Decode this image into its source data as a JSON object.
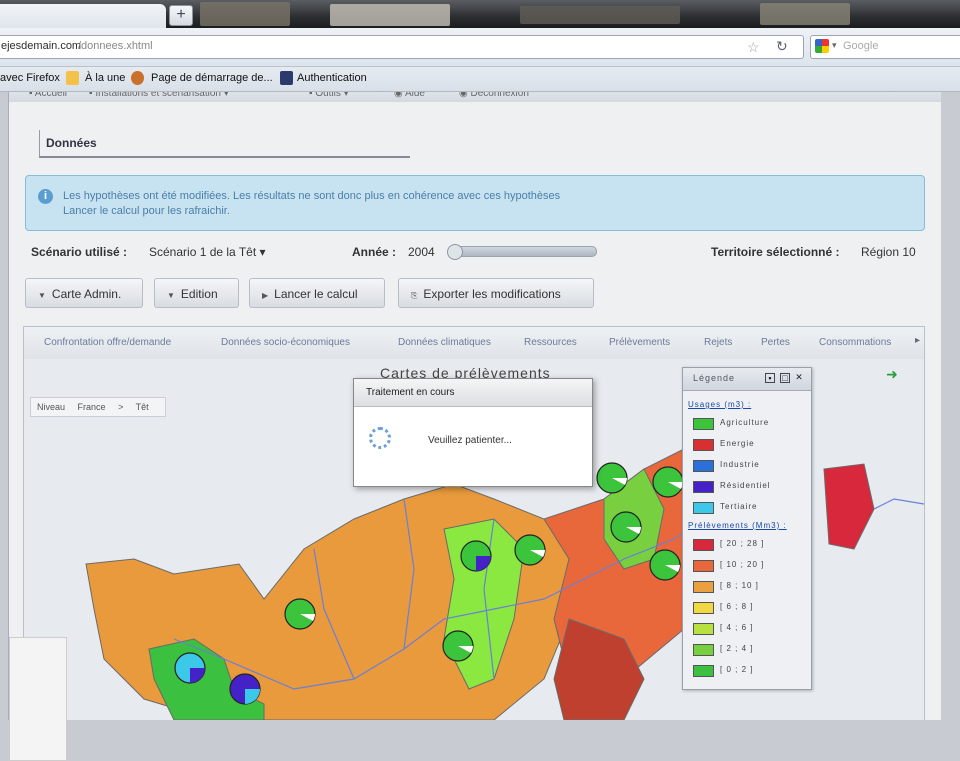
{
  "browser": {
    "new_tab_symbol": "+",
    "url_host": "ejesdemain.com",
    "url_path": "/donnees.xhtml",
    "search_placeholder": "Google",
    "bookmarks": [
      "avec Firefox",
      "À la une",
      "Page de démarrage de...",
      "Authentication"
    ]
  },
  "page": {
    "section_title": "Données",
    "info_line1": "Les hypothèses ont été modifiées. Les résultats ne sont donc plus en cohérence avec ces hypothèses",
    "info_line2": "Lancer le calcul pour les rafraichir.",
    "scenario_label": "Scénario utilisé :",
    "scenario_value": "Scénario 1 de la Têt ▾",
    "year_label": "Année :",
    "year_value": "2004",
    "territory_label": "Territoire sélectionné :",
    "territory_value": "Région 10",
    "buttons": {
      "carte": "Carte Admin.",
      "edition": "Edition",
      "lancer": "Lancer le calcul",
      "exporter": "Exporter les modifications"
    },
    "tabs": [
      "Confrontation offre/demande",
      "Données socio-économiques",
      "Données climatiques",
      "Ressources",
      "Prélèvements",
      "Rejets",
      "Pertes",
      "Consommations"
    ],
    "map_title": "Cartes de prélèvements",
    "breadcrumb": [
      "Niveau",
      "France",
      ">",
      "Têt"
    ]
  },
  "dialog": {
    "title": "Traitement en cours",
    "message": "Veuillez patienter..."
  },
  "legend": {
    "title": "Légende",
    "uses_title": "Usages (m3) :",
    "uses": [
      {
        "label": "Agriculture",
        "color": "#3cc43c"
      },
      {
        "label": "Energie",
        "color": "#d83030"
      },
      {
        "label": "Industrie",
        "color": "#2b6fd8"
      },
      {
        "label": "Résidentiel",
        "color": "#4422c8"
      },
      {
        "label": "Tertiaire",
        "color": "#3cc8e8"
      }
    ],
    "volumes_title": "Prélèvements (Mm3) :",
    "volumes": [
      {
        "label": "[ 20 ; 28 ]",
        "color": "#d8283c"
      },
      {
        "label": "[ 10 ; 20 ]",
        "color": "#e8683c"
      },
      {
        "label": "[ 8 ; 10 ]",
        "color": "#eaa040"
      },
      {
        "label": "[ 6 ; 8 ]",
        "color": "#f0d840"
      },
      {
        "label": "[ 4 ; 6 ]",
        "color": "#b8e040"
      },
      {
        "label": "[ 2 ; 4 ]",
        "color": "#78d040"
      },
      {
        "label": "[ 0 ; 2 ]",
        "color": "#3cc040"
      }
    ]
  }
}
